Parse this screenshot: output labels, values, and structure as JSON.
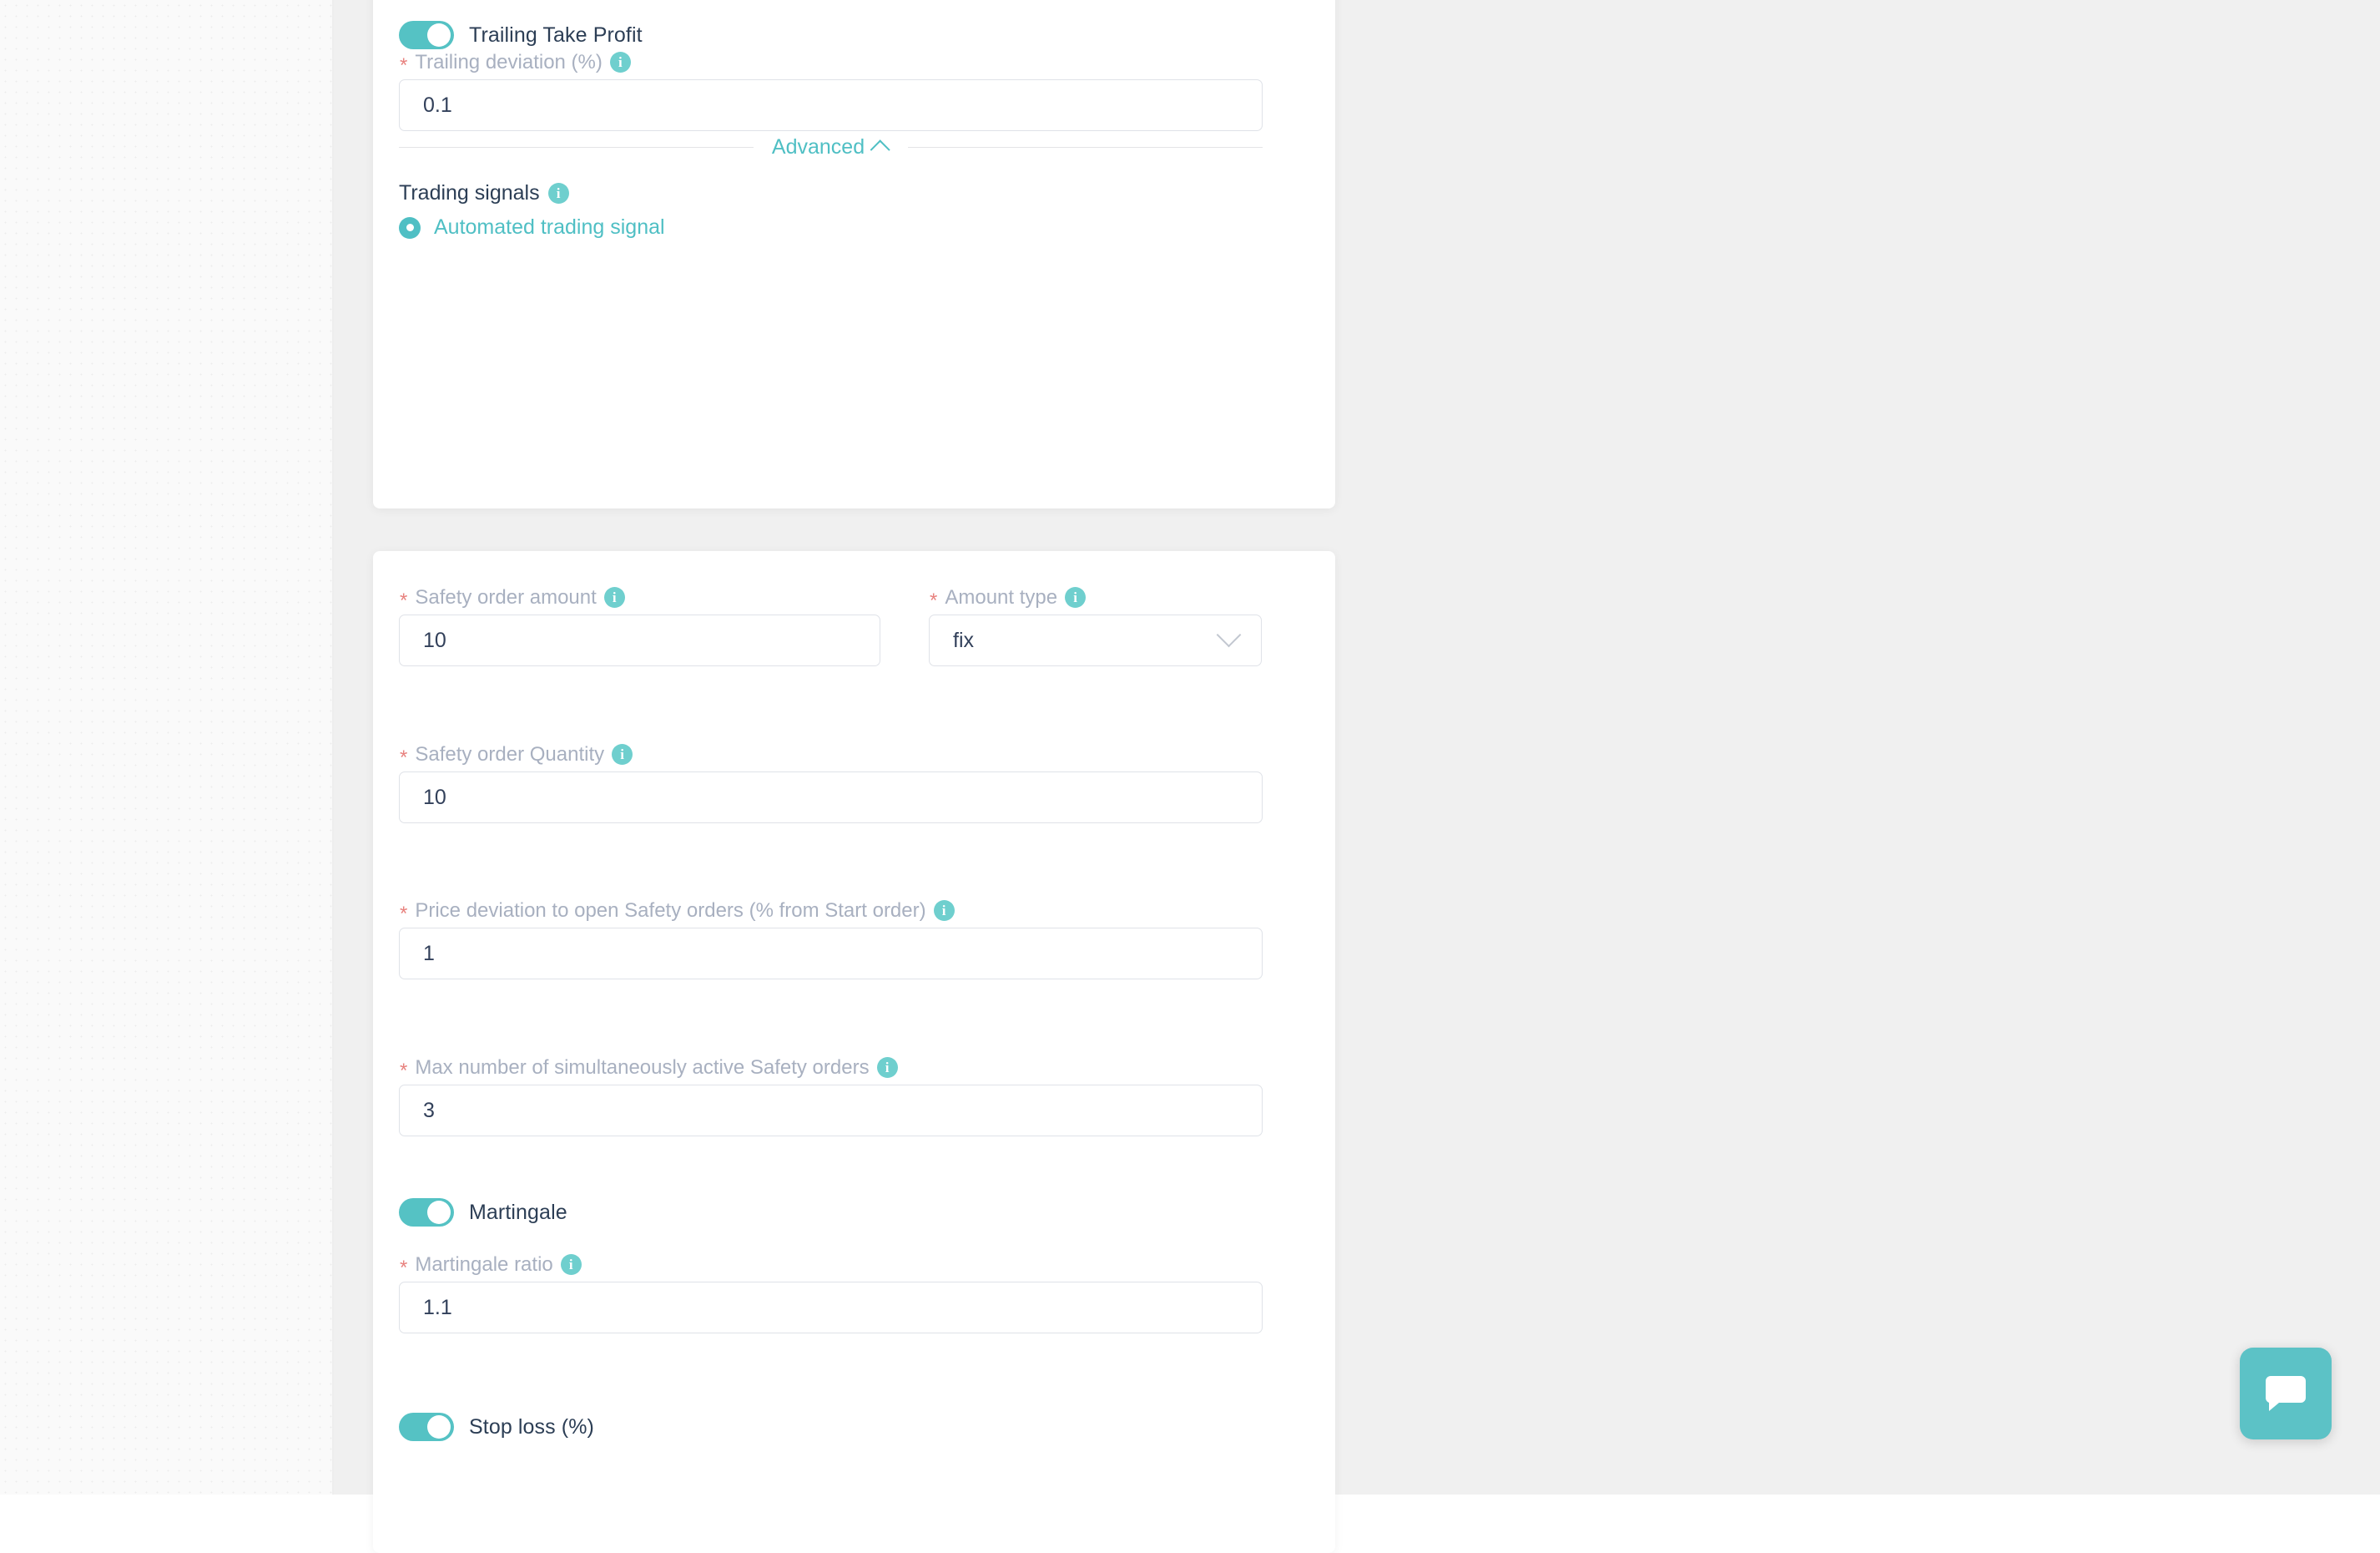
{
  "take_profit_card": {
    "trailing_take_profit": {
      "label": "Trailing Take Profit",
      "enabled": true
    },
    "trailing_deviation": {
      "label": "Trailing deviation (%)",
      "required_marker": "*",
      "info_glyph": "i",
      "value": "0.1"
    },
    "advanced": {
      "label": "Advanced",
      "chevron": "chevron-up"
    },
    "trading_signals": {
      "label": "Trading signals",
      "info_glyph": "i",
      "options": [
        {
          "label": "Automated trading signal",
          "selected": true
        }
      ]
    }
  },
  "safety_orders_card": {
    "safety_order_amount": {
      "label": "Safety order amount",
      "required_marker": "*",
      "info_glyph": "i",
      "value": "10"
    },
    "amount_type": {
      "label": "Amount type",
      "required_marker": "*",
      "info_glyph": "i",
      "value": "fix"
    },
    "safety_order_quantity": {
      "label": "Safety order Quantity",
      "required_marker": "*",
      "info_glyph": "i",
      "value": "10"
    },
    "price_deviation": {
      "label": "Price deviation to open Safety orders (% from Start order)",
      "required_marker": "*",
      "info_glyph": "i",
      "value": "1"
    },
    "max_active_safety_orders": {
      "label": "Max number of simultaneously active Safety orders",
      "required_marker": "*",
      "info_glyph": "i",
      "value": "3"
    },
    "martingale": {
      "label": "Martingale",
      "enabled": true
    },
    "martingale_ratio": {
      "label": "Martingale ratio",
      "required_marker": "*",
      "info_glyph": "i",
      "value": "1.1"
    },
    "stop_loss": {
      "label": "Stop loss (%)",
      "enabled": true
    }
  },
  "chat_widget": {
    "icon": "chat-bubble-icon"
  },
  "colors": {
    "accent_teal": "#4fbfc4",
    "toggle_on": "#55c2c4",
    "info_icon": "#6fcfce",
    "required_red": "#e8827f",
    "label_grey": "#a8b0c0",
    "text_navy": "#2c3e55",
    "input_border": "#dfe2e8",
    "page_bg": "#f0f0f0",
    "card_bg": "#ffffff"
  }
}
